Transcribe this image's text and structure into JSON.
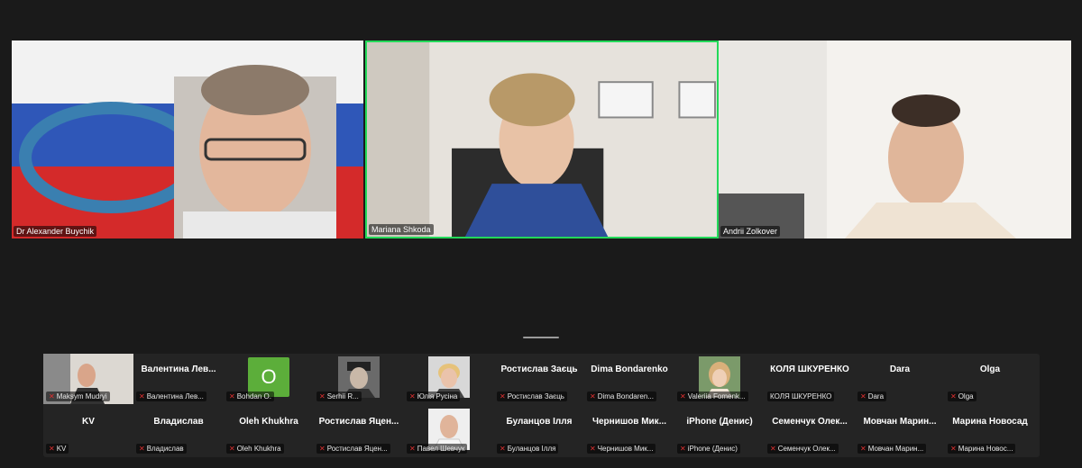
{
  "videos": [
    {
      "name": "Dr Alexander Buychik"
    },
    {
      "name": "Mariana Shkoda"
    },
    {
      "name": "Andrii Zolkover"
    }
  ],
  "gallery_row1": [
    {
      "title": "",
      "label": "Maksym Mudryi",
      "muted": true,
      "kind": "photo-full"
    },
    {
      "title": "Валентина  Лев...",
      "label": "Валентина Лев...",
      "muted": true,
      "kind": "text"
    },
    {
      "title": "",
      "label": "Bohdan O.",
      "muted": true,
      "kind": "avatar",
      "avatar_letter": "O"
    },
    {
      "title": "",
      "label": "Serhii R...",
      "muted": true,
      "kind": "photo"
    },
    {
      "title": "",
      "label": "Юлія Русіна",
      "muted": true,
      "kind": "photo"
    },
    {
      "title": "Ростислав Заєць",
      "label": "Ростислав Заєць",
      "muted": true,
      "kind": "text"
    },
    {
      "title": "Dima Bondarenko",
      "label": "Dima Bondaren...",
      "muted": true,
      "kind": "text"
    },
    {
      "title": "",
      "label": "Valeriia Fomenk...",
      "muted": true,
      "kind": "photo"
    },
    {
      "title": "КОЛЯ ШКУРЕНКО",
      "label": "КОЛЯ ШКУРЕНКО",
      "muted": false,
      "kind": "text"
    },
    {
      "title": "Dara",
      "label": "Dara",
      "muted": true,
      "kind": "text"
    },
    {
      "title": "Olga",
      "label": "Olga",
      "muted": true,
      "kind": "text"
    }
  ],
  "gallery_row2": [
    {
      "title": "KV",
      "label": "KV",
      "muted": true,
      "kind": "text"
    },
    {
      "title": "Владислав",
      "label": "Владислав",
      "muted": true,
      "kind": "text"
    },
    {
      "title": "Oleh Khukhra",
      "label": "Oleh Khukhra",
      "muted": true,
      "kind": "text"
    },
    {
      "title": "Ростислав  Яцен...",
      "label": "Ростислав Яцен...",
      "muted": true,
      "kind": "text"
    },
    {
      "title": "",
      "label": "Павел Шевчук",
      "muted": true,
      "kind": "photo"
    },
    {
      "title": "Буланцов Ілля",
      "label": "Буланцов Ілля",
      "muted": true,
      "kind": "text"
    },
    {
      "title": "Чернишов  Мик...",
      "label": "Чернишов Мик...",
      "muted": true,
      "kind": "text"
    },
    {
      "title": "iPhone (Денис)",
      "label": "iPhone (Денис)",
      "muted": true,
      "kind": "text"
    },
    {
      "title": "Семенчук  Олек...",
      "label": "Семенчук Олек...",
      "muted": true,
      "kind": "text"
    },
    {
      "title": "Мовчан  Марин...",
      "label": "Мовчан Марин...",
      "muted": true,
      "kind": "text"
    },
    {
      "title": "Марина Новосад",
      "label": "Марина Новос...",
      "muted": true,
      "kind": "text"
    }
  ],
  "colors": {
    "background": "#1a1a1a",
    "strip": "#242424",
    "active_speaker_border": "#23d959",
    "mute_icon": "#e02f2f",
    "avatar_bg": "#5cae3a"
  }
}
